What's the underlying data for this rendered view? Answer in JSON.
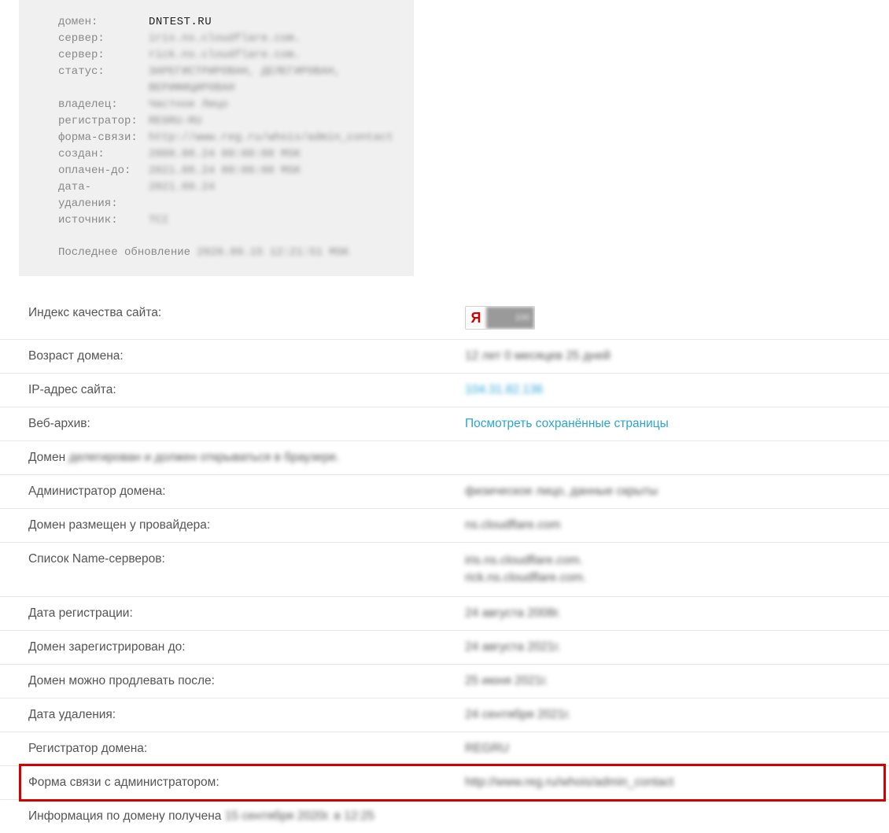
{
  "whois": {
    "rows": [
      {
        "label": "домен:",
        "value": "DNTEST.RU",
        "clear": true
      },
      {
        "label": "сервер:",
        "value": "iris.ns.cloudflare.com.",
        "clear": false
      },
      {
        "label": "сервер:",
        "value": "rick.ns.cloudflare.com.",
        "clear": false
      },
      {
        "label": "статус:",
        "value": "ЗАРЕГИСТРИРОВАН, ДЕЛЕГИРОВАН, ВЕРИФИЦИРОВАН",
        "clear": false
      },
      {
        "label": "владелец:",
        "value": "Частное Лицо",
        "clear": false
      },
      {
        "label": "регистратор:",
        "value": "REGRU-RU",
        "clear": false
      },
      {
        "label": "форма-связи:",
        "value": "http://www.reg.ru/whois/admin_contact",
        "clear": false
      },
      {
        "label": "создан:",
        "value": "2008.08.24 00:00:00 MSK",
        "clear": false
      },
      {
        "label": "оплачен-до:",
        "value": "2021.08.24 00:00:00 MSK",
        "clear": false
      },
      {
        "label": "дата-удаления:",
        "value": "2021.09.24",
        "clear": false
      },
      {
        "label": "источник:",
        "value": "TCI",
        "clear": false
      }
    ],
    "footer_label": "Последнее обновление",
    "footer_value": "2020.09.15 12:21:51 MSK"
  },
  "yandex_letter": "Я",
  "info": {
    "quality_label": "Индекс качества сайта:",
    "age_label": "Возраст домена:",
    "age_value": "12 лет 0 месяцев 25 дней",
    "ip_label": "IP-адрес сайта:",
    "ip_value": "104.31.82.136",
    "archive_label": "Веб-архив:",
    "archive_value": "Посмотреть сохранённые страницы",
    "domain_prefix": "Домен",
    "domain_status": "делегирован и должен открываться в браузере.",
    "admin_label": "Администратор домена:",
    "admin_value": "физическое лицо, данные скрыты",
    "provider_label": "Домен размещен у провайдера:",
    "provider_value": "ns.cloudflare.com",
    "ns_label": "Список Name-серверов:",
    "ns_value_1": "iris.ns.cloudflare.com.",
    "ns_value_2": "rick.ns.cloudflare.com.",
    "regdate_label": "Дата регистрации:",
    "regdate_value": "24 августа 2008г.",
    "reguntil_label": "Домен зарегистрирован до:",
    "reguntil_value": "24 августа 2021г.",
    "renew_label": "Домен можно продлевать после:",
    "renew_value": "25 июня 2021г.",
    "delete_label": "Дата удаления:",
    "delete_value": "24 сентября 2021г.",
    "registrar_label": "Регистратор домена:",
    "registrar_value": "REGRU",
    "contact_label": "Форма связи с администратором:",
    "contact_value": "http://www.reg.ru/whois/admin_contact",
    "infodate_prefix": "Информация по домену получена",
    "infodate_value": "15 сентября 2020г. в 12:25"
  }
}
